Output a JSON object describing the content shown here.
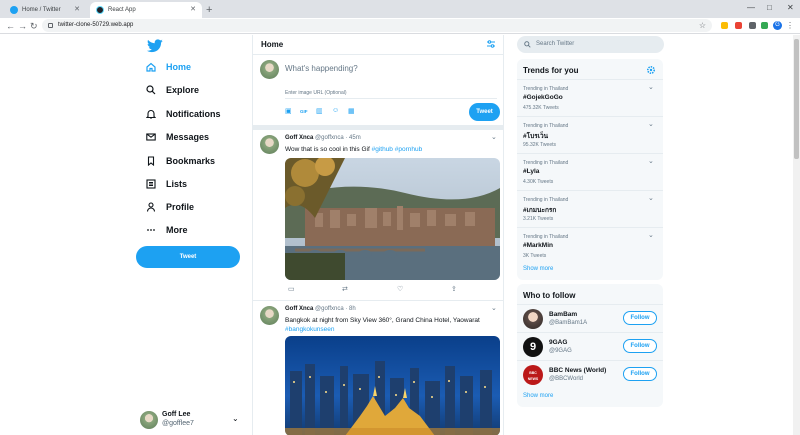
{
  "browser": {
    "tabs": [
      {
        "title": "Home / Twitter",
        "active": false
      },
      {
        "title": "React App",
        "active": true
      }
    ],
    "url": "twitter-clone-50729.web.app",
    "profile_initial": "G"
  },
  "sidebar": {
    "items": [
      {
        "label": "Home",
        "icon": "home-icon",
        "active": true
      },
      {
        "label": "Explore",
        "icon": "search-icon"
      },
      {
        "label": "Notifications",
        "icon": "bell-icon"
      },
      {
        "label": "Messages",
        "icon": "mail-icon"
      },
      {
        "label": "Bookmarks",
        "icon": "bookmark-icon"
      },
      {
        "label": "Lists",
        "icon": "list-icon"
      },
      {
        "label": "Profile",
        "icon": "person-icon"
      },
      {
        "label": "More",
        "icon": "more-icon"
      }
    ],
    "tweet_button": "Tweet",
    "user": {
      "name": "Goff Lee",
      "handle": "@gofflee7"
    }
  },
  "feed": {
    "title": "Home",
    "compose": {
      "placeholder": "What's happending?",
      "image_url_placeholder": "Enter image URL (Optional)",
      "tweet_button": "Tweet",
      "tools": [
        "image-icon",
        "gif-icon",
        "poll-icon",
        "emoji-icon",
        "schedule-icon"
      ],
      "gif_label": "GIF"
    },
    "posts": [
      {
        "name": "Goff Xnca",
        "handle": "@goffxnca",
        "time": "45m",
        "text": "Wow that is so cool in this Gif ",
        "hashtags": "#github #pornhub"
      },
      {
        "name": "Goff Xnca",
        "handle": "@goffxnca",
        "time": "8h",
        "text": "Bangkok at night from Sky View 360°, Grand China Hotel, Yaowarat ",
        "hashtags": "#bangkokunseen"
      }
    ]
  },
  "right": {
    "search_placeholder": "Search Twitter",
    "trends_title": "Trends for you",
    "trends": [
      {
        "context": "Trending in Thailand",
        "tag": "#GojekGoGo",
        "count": "475.32K Tweets"
      },
      {
        "context": "Trending in Thailand",
        "tag": "#โบรเว็น",
        "count": "95.32K Tweets"
      },
      {
        "context": "Trending in Thailand",
        "tag": "#Lyla",
        "count": "4.30K Tweets"
      },
      {
        "context": "Trending in Thailand",
        "tag": "#เกมนะกรก",
        "count": "3.21K Tweets"
      },
      {
        "context": "Trending in Thailand",
        "tag": "#MarkMin",
        "count": "3K Tweets"
      }
    ],
    "show_more": "Show more",
    "follow_title": "Who to follow",
    "follow": [
      {
        "name": "BamBam",
        "handle": "@BamBam1A",
        "button": "Follow"
      },
      {
        "name": "9GAG",
        "handle": "@9GAG",
        "button": "Follow"
      },
      {
        "name": "BBC News (World)",
        "handle": "@BBCWorld",
        "button": "Follow"
      }
    ],
    "follow_show_more": "Show more"
  },
  "colors": {
    "accent": "#1da1f2",
    "border": "#e6ecf0",
    "panel": "#f5f8fa"
  }
}
